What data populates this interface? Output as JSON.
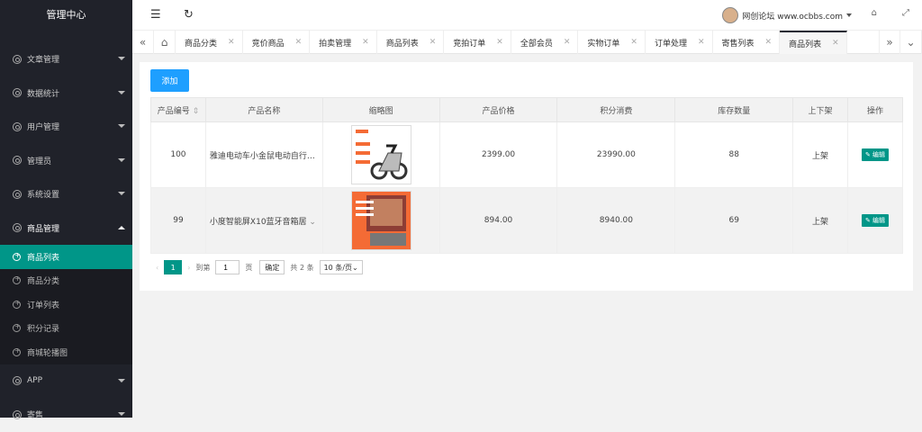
{
  "app_title": "管理中心",
  "sidebar": {
    "items": [
      {
        "label": "文章管理"
      },
      {
        "label": "数据统计"
      },
      {
        "label": "用户管理"
      },
      {
        "label": "管理员"
      },
      {
        "label": "系统设置"
      },
      {
        "label": "商品管理"
      }
    ],
    "sub": [
      "商品列表",
      "商品分类",
      "订单列表",
      "积分记录",
      "商城轮播图"
    ],
    "after": [
      {
        "label": "APP"
      },
      {
        "label": "寄售"
      }
    ]
  },
  "header": {
    "user": "网创论坛 www.ocbbs.com"
  },
  "tabs": [
    "商品分类",
    "竞价商品",
    "拍卖管理",
    "商品列表",
    "竞拍订单",
    "全部会员",
    "实物订单",
    "订单处理",
    "寄售列表",
    "商品列表"
  ],
  "main": {
    "add_label": "添加",
    "columns": [
      "产品编号",
      "产品名称",
      "缩略图",
      "产品价格",
      "积分消费",
      "库存数量",
      "上下架",
      "操作"
    ],
    "rows": [
      {
        "id": "100",
        "name": "雅迪电动车小金鼠电动自行…",
        "price": "2399.00",
        "points": "23990.00",
        "stock": "88",
        "status": "上架",
        "action": "编辑"
      },
      {
        "id": "99",
        "name": "小度智能屏X10蓝牙音箱居",
        "price": "894.00",
        "points": "8940.00",
        "stock": "69",
        "status": "上架",
        "action": "编辑"
      }
    ]
  },
  "pager": {
    "page": "1",
    "goto": "到第",
    "page_unit": "页",
    "confirm": "确定",
    "total": "共 2 条",
    "size": "10 条/页"
  }
}
